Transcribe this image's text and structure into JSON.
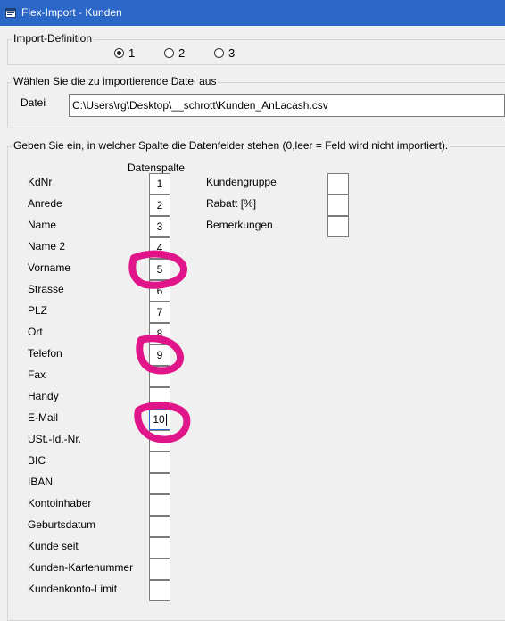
{
  "window": {
    "title": "Flex-Import - Kunden"
  },
  "import_definition": {
    "title": "Import-Definition",
    "options": [
      "1",
      "2",
      "3"
    ],
    "selected": "1"
  },
  "file_section": {
    "title": "Wählen Sie die zu importierende Datei aus",
    "label": "Datei",
    "path": "C:\\Users\\rg\\Desktop\\__schrott\\Kunden_AnLacash.csv"
  },
  "fields_section": {
    "title": "Geben Sie ein, in welcher Spalte die Datenfelder stehen (0,leer = Feld wird nicht importiert).",
    "column_header": "Datenspalte",
    "left_fields": [
      {
        "label": "KdNr",
        "value": "1"
      },
      {
        "label": "Anrede",
        "value": "2"
      },
      {
        "label": "Name",
        "value": "3"
      },
      {
        "label": "Name 2",
        "value": "4"
      },
      {
        "label": "Vorname",
        "value": "5"
      },
      {
        "label": "Strasse",
        "value": "6"
      },
      {
        "label": "PLZ",
        "value": "7"
      },
      {
        "label": "Ort",
        "value": "8"
      },
      {
        "label": "Telefon",
        "value": "9"
      },
      {
        "label": "Fax",
        "value": ""
      },
      {
        "label": "Handy",
        "value": ""
      },
      {
        "label": "E-Mail",
        "value": "10"
      },
      {
        "label": "USt.-Id.-Nr.",
        "value": ""
      },
      {
        "label": "BIC",
        "value": ""
      },
      {
        "label": "IBAN",
        "value": ""
      },
      {
        "label": "Kontoinhaber",
        "value": ""
      },
      {
        "label": "Geburtsdatum",
        "value": ""
      },
      {
        "label": "Kunde seit",
        "value": ""
      },
      {
        "label": "Kunden-Kartenummer",
        "value": ""
      },
      {
        "label": "Kundenkonto-Limit",
        "value": ""
      }
    ],
    "right_fields": [
      {
        "label": "Kundengruppe",
        "value": ""
      },
      {
        "label": "Rabatt [%]",
        "value": ""
      },
      {
        "label": "Bemerkungen",
        "value": ""
      }
    ]
  },
  "colors": {
    "titlebar": "#2b67c6",
    "annotation": "#e0158a",
    "focus_border": "#2b67c6"
  }
}
